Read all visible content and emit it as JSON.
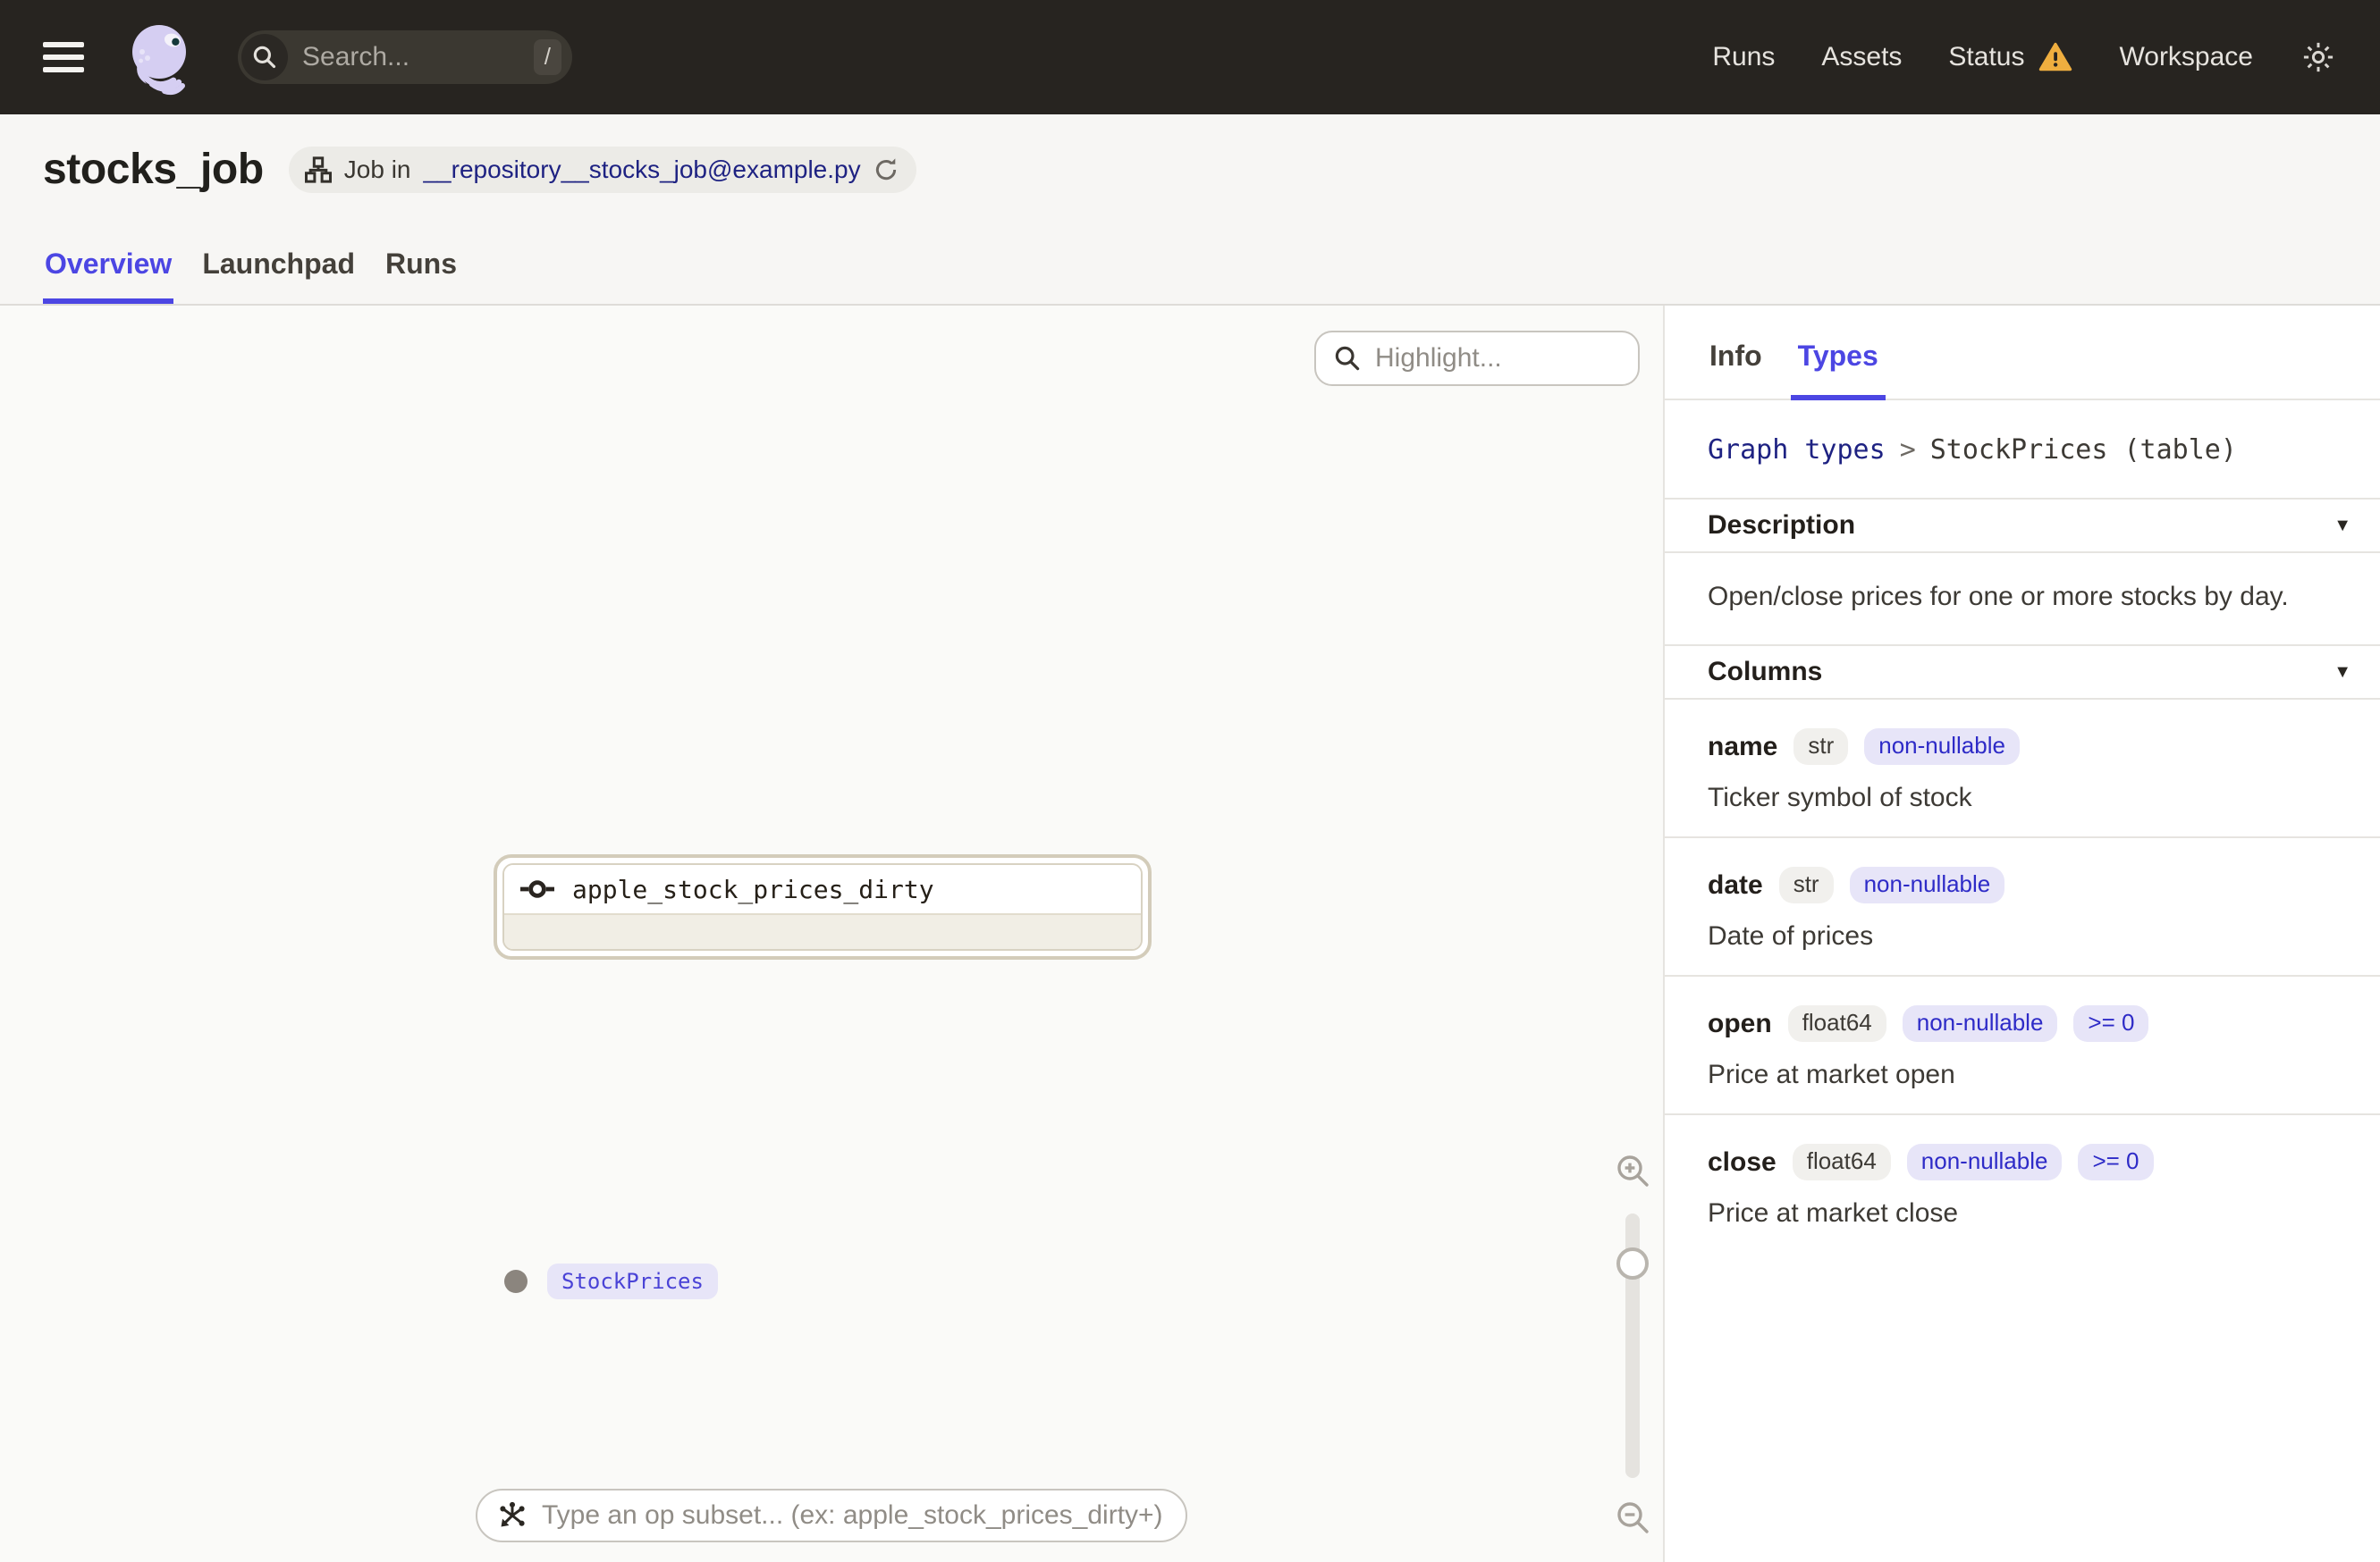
{
  "navbar": {
    "search": {
      "placeholder": "Search...",
      "shortcut": "/"
    },
    "links": {
      "runs": "Runs",
      "assets": "Assets",
      "status": "Status",
      "workspace": "Workspace"
    }
  },
  "header": {
    "title": "stocks_job",
    "job_pill": {
      "prefix": "Job in",
      "link": "__repository__stocks_job@example.py"
    },
    "tabs": {
      "overview": "Overview",
      "launchpad": "Launchpad",
      "runs": "Runs"
    }
  },
  "canvas": {
    "highlight_placeholder": "Highlight...",
    "op_subset_placeholder": "Type an op subset... (ex: apple_stock_prices_dirty+)",
    "node": {
      "name": "apple_stock_prices_dirty",
      "output_type": "StockPrices"
    }
  },
  "panel": {
    "tabs": {
      "info": "Info",
      "types": "Types"
    },
    "breadcrumb": {
      "parent": "Graph types",
      "separator": ">",
      "current": "StockPrices (table)"
    },
    "description": {
      "title": "Description",
      "text": "Open/close prices for one or more stocks by day."
    },
    "columns": {
      "title": "Columns",
      "items": [
        {
          "name": "name",
          "type": "str",
          "constraints": [
            "non-nullable"
          ],
          "description": "Ticker symbol of stock"
        },
        {
          "name": "date",
          "type": "str",
          "constraints": [
            "non-nullable"
          ],
          "description": "Date of prices"
        },
        {
          "name": "open",
          "type": "float64",
          "constraints": [
            "non-nullable",
            ">= 0"
          ],
          "description": "Price at market open"
        },
        {
          "name": "close",
          "type": "float64",
          "constraints": [
            "non-nullable",
            ">= 0"
          ],
          "description": "Price at market close"
        }
      ]
    }
  },
  "colors": {
    "accent": "#4C46E3",
    "link_navy": "#1E2282",
    "warning_amber": "#EFAE3F",
    "navbar_bg": "#272420",
    "canvas_bg": "#FAFAF8",
    "node_border": "#D3CCBA",
    "type_badge_bg": "#E7E5F8",
    "type_badge_text": "#2E2BC7"
  }
}
